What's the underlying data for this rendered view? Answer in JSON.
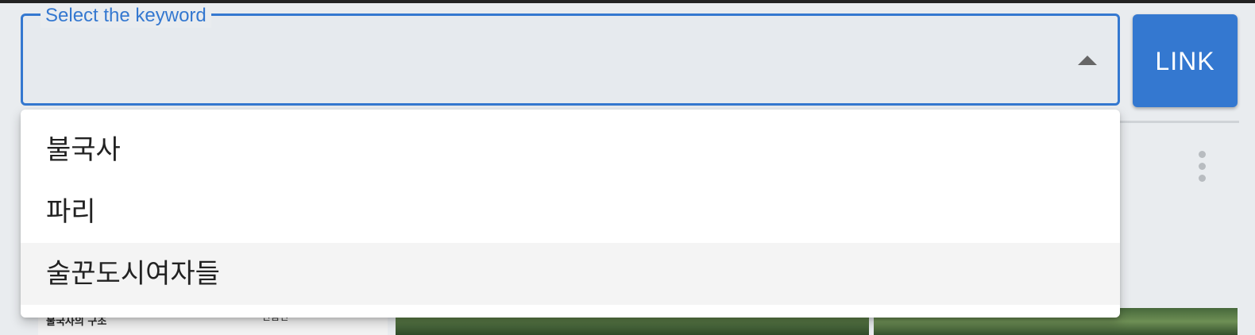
{
  "select": {
    "label": "Select the keyword",
    "value": "",
    "options": [
      {
        "label": "불국사"
      },
      {
        "label": "파리"
      },
      {
        "label": "술꾼도시여자들"
      }
    ],
    "highlighted_option": 2
  },
  "link_button": {
    "label": "LINK"
  },
  "background": {
    "doc_thumb_title": "불국사의 구조",
    "doc_thumb_tag": "관음전"
  },
  "colors": {
    "accent": "#3478d0",
    "background": "#e9ecef",
    "dropdown_bg": "#ffffff",
    "highlight_bg": "#f4f4f4"
  },
  "icons": {
    "select_caret": "caret-up-icon",
    "card_menu": "more-vertical-icon"
  }
}
